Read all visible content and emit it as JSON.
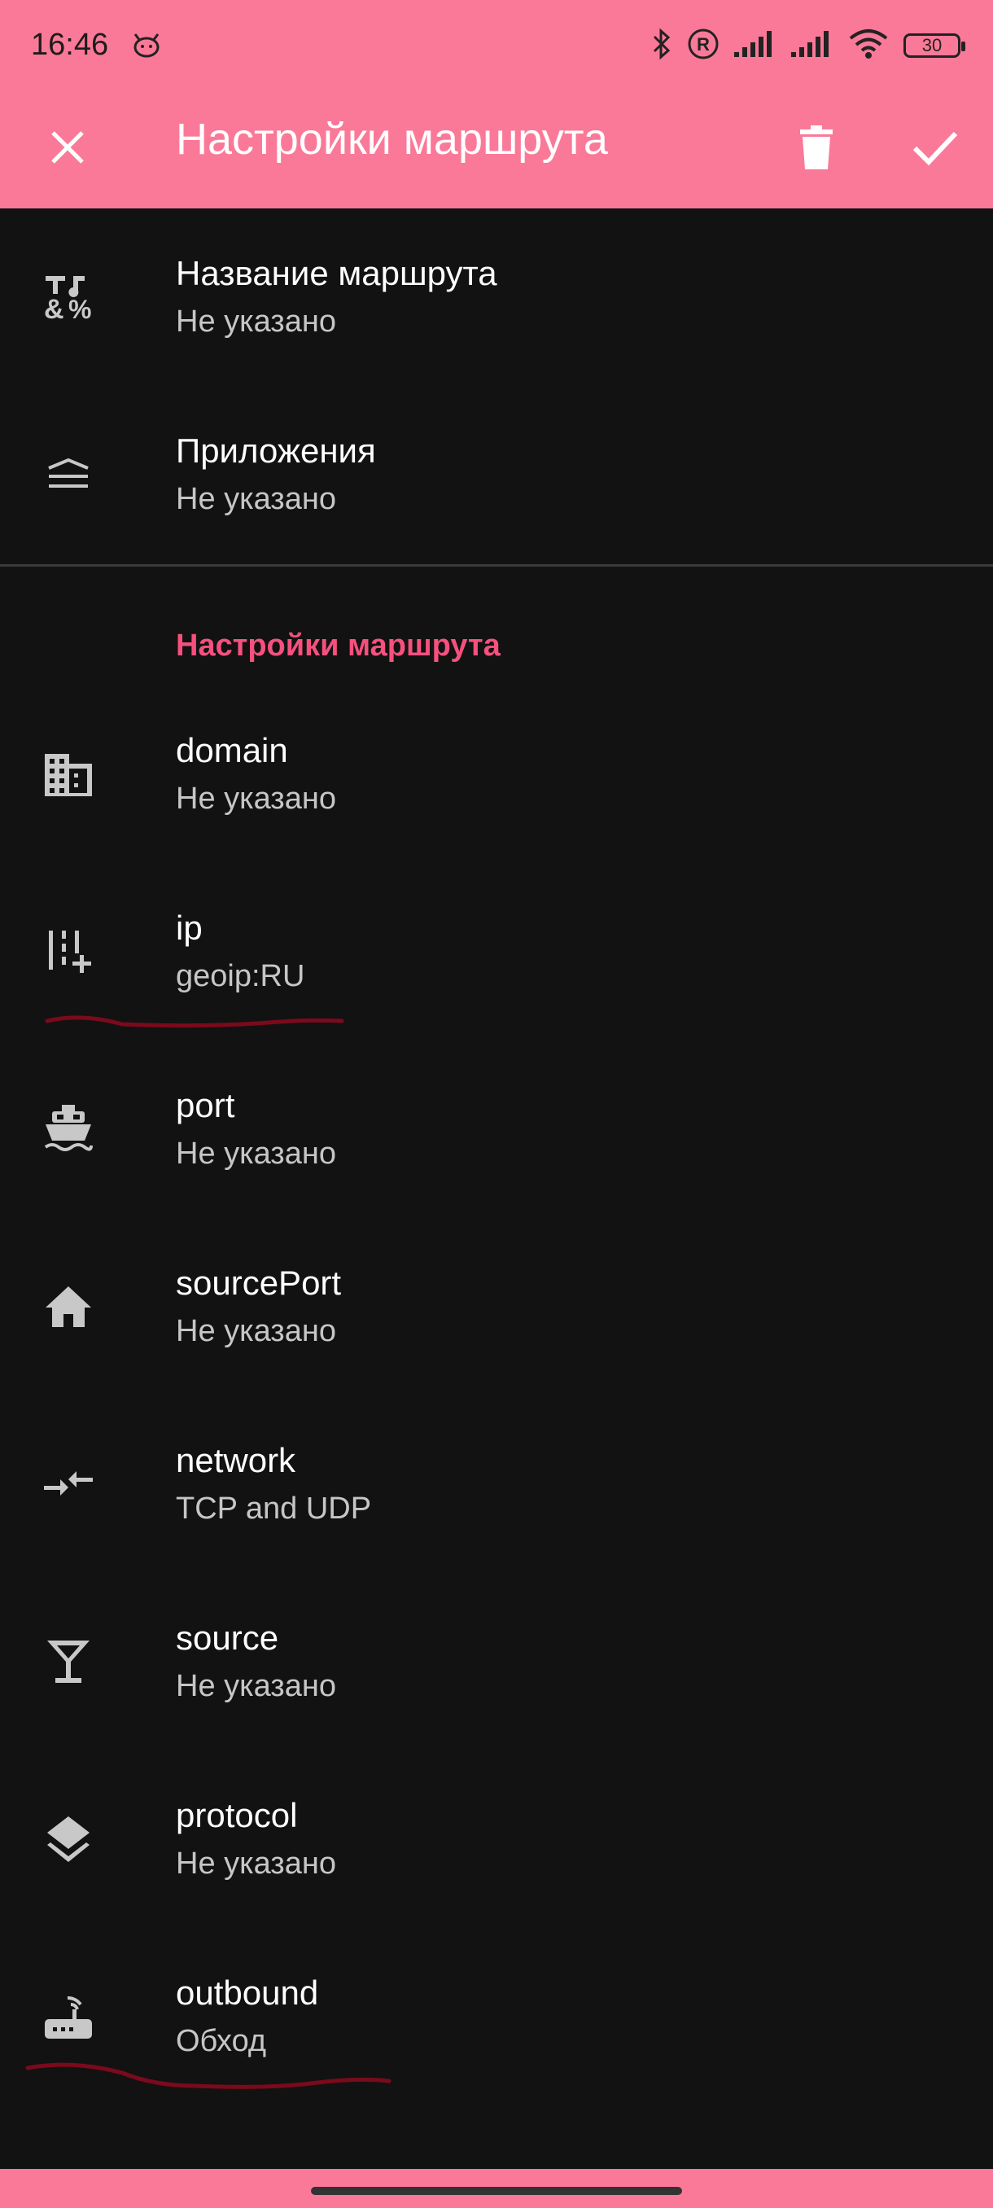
{
  "status_bar": {
    "time": "16:46",
    "battery": "30"
  },
  "appbar": {
    "title": "Настройки маршрута",
    "close_icon": "close-icon",
    "delete_icon": "trash-icon",
    "confirm_icon": "check-icon"
  },
  "top_items": [
    {
      "title": "Название маршрута",
      "value": "Не указано",
      "icon": "text-format-icon"
    },
    {
      "title": "Приложения",
      "value": "Не указано",
      "icon": "apps-stack-icon"
    }
  ],
  "section_header": "Настройки маршрута",
  "route_items": [
    {
      "title": "domain",
      "value": "Не указано",
      "icon": "building-icon"
    },
    {
      "title": "ip",
      "value": "geoip:RU",
      "icon": "ip-add-icon"
    },
    {
      "title": "port",
      "value": "Не указано",
      "icon": "ship-icon"
    },
    {
      "title": "sourcePort",
      "value": "Не указано",
      "icon": "home-icon"
    },
    {
      "title": "network",
      "value": "TCP and UDP",
      "icon": "merge-arrows-icon"
    },
    {
      "title": "source",
      "value": "Не указано",
      "icon": "cocktail-glass-icon"
    },
    {
      "title": "protocol",
      "value": "Не указано",
      "icon": "layers-icon"
    },
    {
      "title": "outbound",
      "value": "Обход",
      "icon": "router-icon"
    }
  ],
  "colors": {
    "accent": "#FB7998",
    "section_header": "#F6507E",
    "background": "#121212",
    "annotation": "#7a0a1c"
  }
}
